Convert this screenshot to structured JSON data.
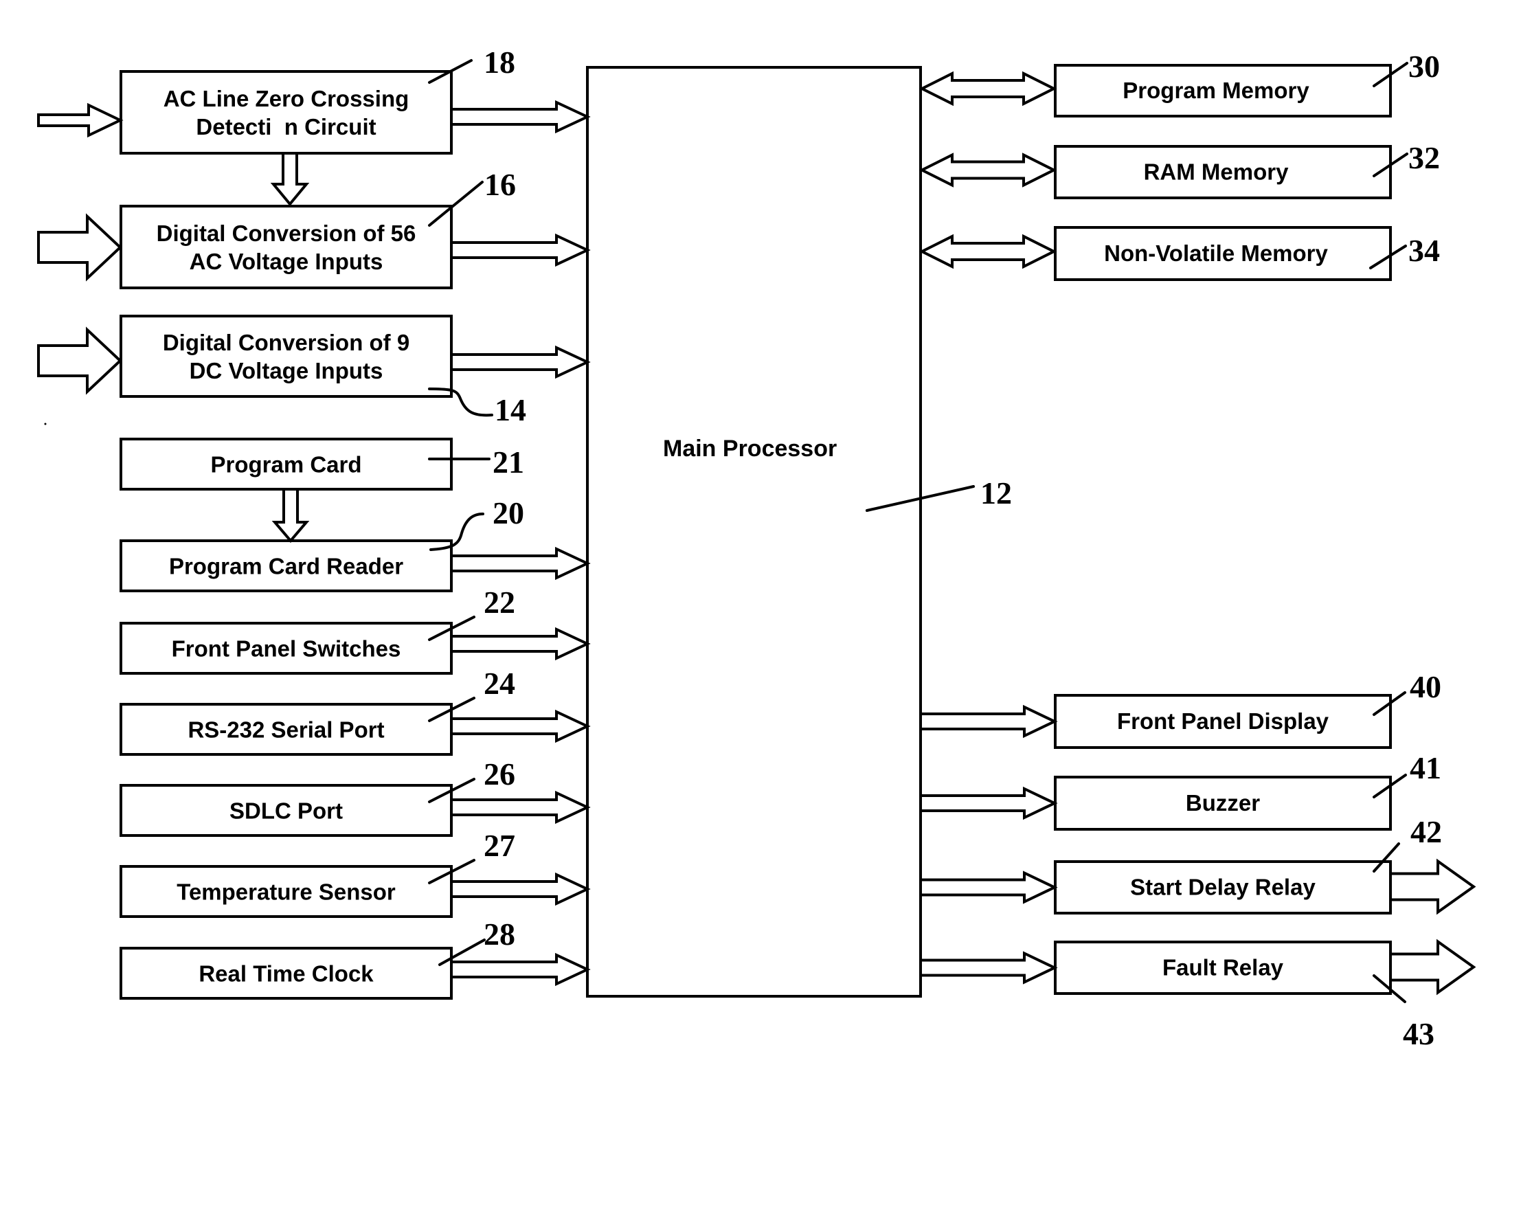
{
  "figure": {
    "main_processor": {
      "label": "Main Processor",
      "ref": "12"
    },
    "inputs": [
      {
        "id": "ac-zero-crossing",
        "lines": [
          "AC Line Zero Crossing",
          "Detecti  n Circuit"
        ],
        "ref": "18",
        "external_input": true
      },
      {
        "id": "digital-conversion-ac",
        "lines": [
          "Digital Conversion of 56",
          "AC Voltage Inputs"
        ],
        "ref": "16",
        "external_input": true
      },
      {
        "id": "digital-conversion-dc",
        "lines": [
          "Digital Conversion of 9",
          "DC Voltage Inputs"
        ],
        "ref": "14",
        "external_input": true
      },
      {
        "id": "program-card",
        "lines": [
          "Program Card"
        ],
        "ref": "21",
        "to_processor": false
      },
      {
        "id": "program-card-reader",
        "lines": [
          "Program Card Reader"
        ],
        "ref": "20"
      },
      {
        "id": "front-panel-switches",
        "lines": [
          "Front Panel Switches"
        ],
        "ref": "22"
      },
      {
        "id": "rs232-serial-port",
        "lines": [
          "RS-232 Serial Port"
        ],
        "ref": "24"
      },
      {
        "id": "sdlc-port",
        "lines": [
          "SDLC Port"
        ],
        "ref": "26"
      },
      {
        "id": "temperature-sensor",
        "lines": [
          "Temperature Sensor"
        ],
        "ref": "27"
      },
      {
        "id": "real-time-clock",
        "lines": [
          "Real Time Clock"
        ],
        "ref": "28"
      }
    ],
    "memories": [
      {
        "id": "program-memory",
        "label": "Program Memory",
        "ref": "30",
        "bidirectional": true
      },
      {
        "id": "ram-memory",
        "label": "RAM Memory",
        "ref": "32",
        "bidirectional": true
      },
      {
        "id": "non-volatile-memory",
        "label": "Non-Volatile Memory",
        "ref": "34",
        "bidirectional": true
      }
    ],
    "outputs": [
      {
        "id": "front-panel-display",
        "label": "Front Panel Display",
        "ref": "40",
        "external_output": false
      },
      {
        "id": "buzzer",
        "label": "Buzzer",
        "ref": "41",
        "external_output": false
      },
      {
        "id": "start-delay-relay",
        "label": "Start Delay Relay",
        "ref": "42",
        "external_output": true
      },
      {
        "id": "fault-relay",
        "label": "Fault Relay",
        "ref": "43",
        "external_output": true
      }
    ],
    "connections": [
      {
        "from": "ac-zero-crossing",
        "to": "digital-conversion-ac"
      },
      {
        "from": "program-card",
        "to": "program-card-reader"
      }
    ]
  }
}
